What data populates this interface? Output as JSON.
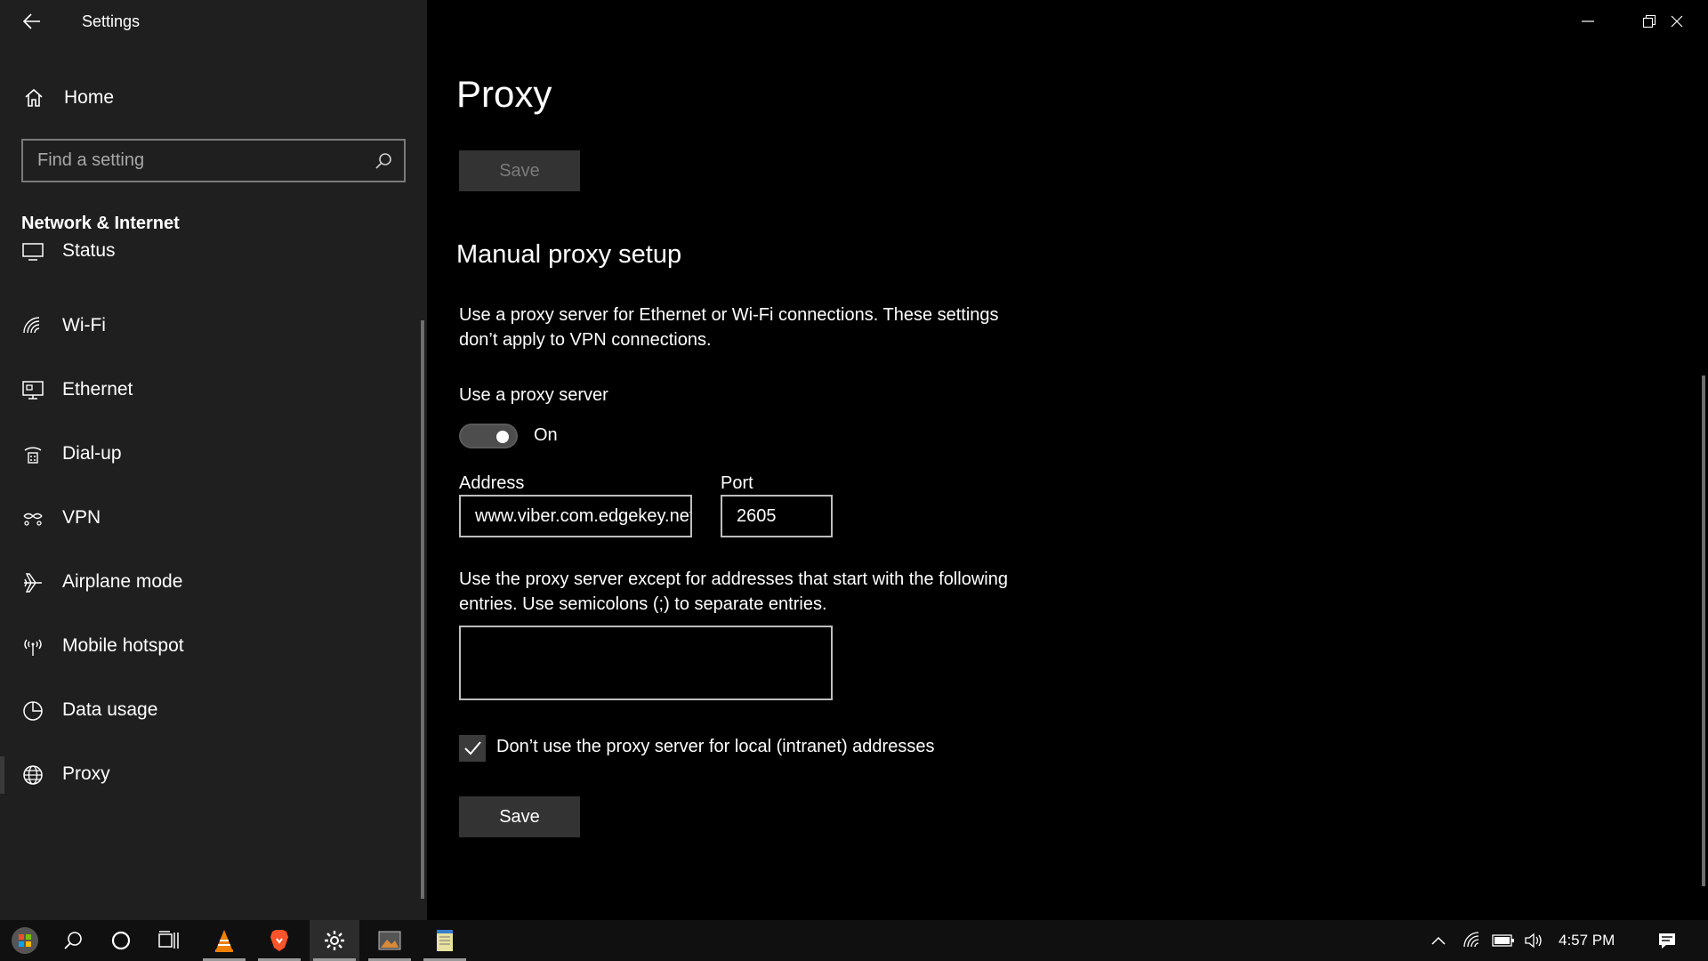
{
  "window": {
    "app_title": "Settings"
  },
  "sidebar": {
    "home_label": "Home",
    "search_placeholder": "Find a setting",
    "section_title": "Network & Internet",
    "items": [
      {
        "label": "Status",
        "icon": "status-icon"
      },
      {
        "label": "Wi-Fi",
        "icon": "wifi-icon"
      },
      {
        "label": "Ethernet",
        "icon": "ethernet-icon"
      },
      {
        "label": "Dial-up",
        "icon": "dialup-icon"
      },
      {
        "label": "VPN",
        "icon": "vpn-icon"
      },
      {
        "label": "Airplane mode",
        "icon": "airplane-icon"
      },
      {
        "label": "Mobile hotspot",
        "icon": "hotspot-icon"
      },
      {
        "label": "Data usage",
        "icon": "data-usage-icon"
      },
      {
        "label": "Proxy",
        "icon": "globe-icon",
        "selected": true
      }
    ]
  },
  "main": {
    "page_title": "Proxy",
    "top_save_label": "Save",
    "manual_setup_heading": "Manual proxy setup",
    "manual_setup_desc_line1": "Use a proxy server for Ethernet or Wi-Fi connections. These settings",
    "manual_setup_desc_line2": "don’t apply to VPN connections.",
    "use_proxy_label": "Use a proxy server",
    "use_proxy_state": "On",
    "address_label": "Address",
    "address_value": "www.viber.com.edgekey.net",
    "port_label": "Port",
    "port_value": "2605",
    "exceptions_desc_line1": "Use the proxy server except for addresses that start with the following",
    "exceptions_desc_line2": "entries. Use semicolons (;) to separate entries.",
    "exceptions_value": "",
    "local_bypass_label": "Don’t use the proxy server for local (intranet) addresses",
    "local_bypass_checked": true,
    "save_label": "Save"
  },
  "taskbar": {
    "clock": "4:57 PM",
    "apps": [
      "start-icon",
      "search-icon",
      "cortana-icon",
      "task-view-icon",
      "vlc-icon",
      "brave-icon",
      "settings-icon",
      "image-app-icon",
      "notepad-icon"
    ]
  },
  "colors": {
    "sidebar_bg": "#1f1f1f",
    "main_bg": "#000000",
    "button_bg": "#333333"
  }
}
